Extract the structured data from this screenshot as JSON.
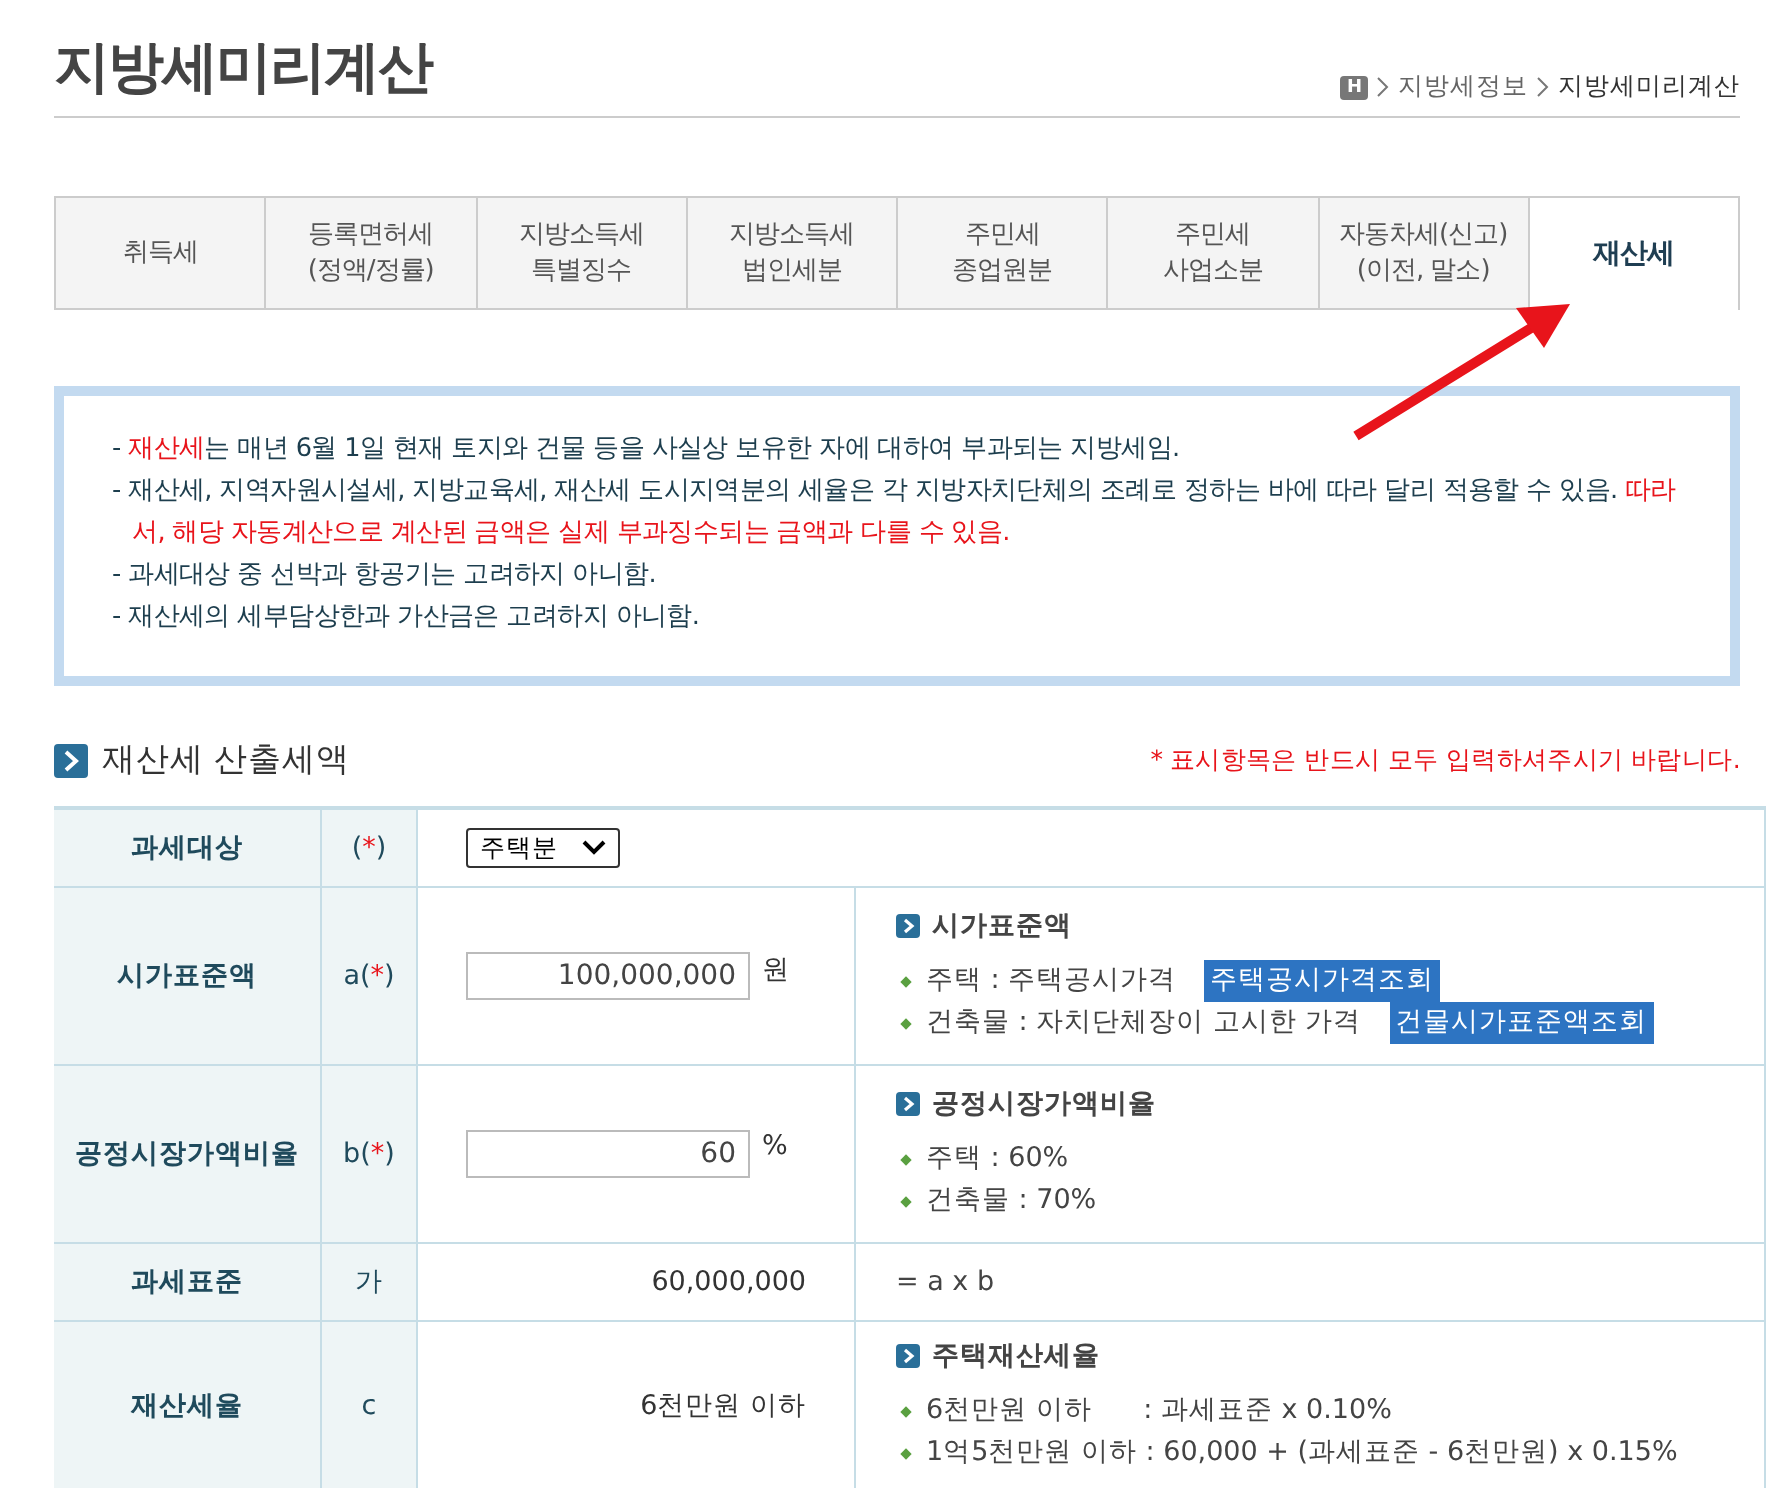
{
  "page_title": "지방세미리계산",
  "breadcrumb": {
    "home": "H",
    "items": [
      "지방세정보",
      "지방세미리계산"
    ]
  },
  "tabs": [
    {
      "label": "취득세",
      "selected": false
    },
    {
      "label": "등록면허세\n(정액/정률)",
      "selected": false
    },
    {
      "label": "지방소득세\n특별징수",
      "selected": false
    },
    {
      "label": "지방소득세\n법인세분",
      "selected": false
    },
    {
      "label": "주민세\n종업원분",
      "selected": false
    },
    {
      "label": "주민세\n사업소분",
      "selected": false
    },
    {
      "label": "자동차세(신고)\n(이전, 말소)",
      "selected": false
    },
    {
      "label": "재산세",
      "selected": true
    }
  ],
  "notice": [
    {
      "segments": [
        {
          "text": "- ",
          "emphasis": false
        },
        {
          "text": "재산세",
          "emphasis": true
        },
        {
          "text": "는 매년 6월 1일 현재 토지와 건물 등을 사실상 보유한 자에 대하여 부과되는 지방세임.",
          "emphasis": false
        }
      ]
    },
    {
      "segments": [
        {
          "text": "- 재산세, 지역자원시설세, 지방교육세, 재산세 도시지역분의 세율은 각 지방자치단체의 조례로 정하는 바에 따라 달리 적용할 수 있음. ",
          "emphasis": false
        },
        {
          "text": "따라서, 해당 자동계산으로 계산된 금액은 실제 부과징수되는 금액과 다를 수 있음.",
          "emphasis": true
        }
      ]
    },
    {
      "segments": [
        {
          "text": "- 과세대상 중 선박과 항공기는 고려하지 아니함.",
          "emphasis": false
        }
      ]
    },
    {
      "segments": [
        {
          "text": "- 재산세의 세부담상한과 가산금은 고려하지 아니함.",
          "emphasis": false
        }
      ]
    }
  ],
  "section": {
    "title": "재산세 산출세액",
    "required_note": "* 표시항목은 반드시 모두 입력하셔주시기 바랍니다."
  },
  "rows": [
    {
      "kind": "select",
      "label": "과세대상",
      "symbol": "",
      "required_mark": "(*)",
      "value": "주택분"
    },
    {
      "kind": "input",
      "label": "시가표준액",
      "symbol": "a",
      "required_mark": "(*)",
      "value": "100,000,000",
      "unit": "원",
      "help_title": "시가표준액",
      "help_items": [
        {
          "text": "주택 : 주택공시가격",
          "link": "주택공시가격조회"
        },
        {
          "text": "건축물 : 자치단체장이 고시한 가격",
          "link": "건물시가표준액조회"
        }
      ]
    },
    {
      "kind": "input",
      "label": "공정시장가액비율",
      "symbol": "b",
      "required_mark": "(*)",
      "value": "60",
      "unit": "%",
      "help_title": "공정시장가액비율",
      "help_items": [
        {
          "text": "주택 : 60%"
        },
        {
          "text": "건축물 : 70%"
        }
      ]
    },
    {
      "kind": "value",
      "label": "과세표준",
      "symbol": "가",
      "value": "60,000,000",
      "formula": "= a x b"
    },
    {
      "kind": "value",
      "label": "재산세율",
      "symbol": "c",
      "value": "6천만원 이하",
      "help_title": "주택재산세율",
      "help_items": [
        {
          "text": "6천만원 이하      : 과세표준 x 0.10%"
        },
        {
          "text": "1억5천만원 이하 : 60,000 + (과세표준 - 6천만원) x 0.15%"
        }
      ]
    }
  ]
}
